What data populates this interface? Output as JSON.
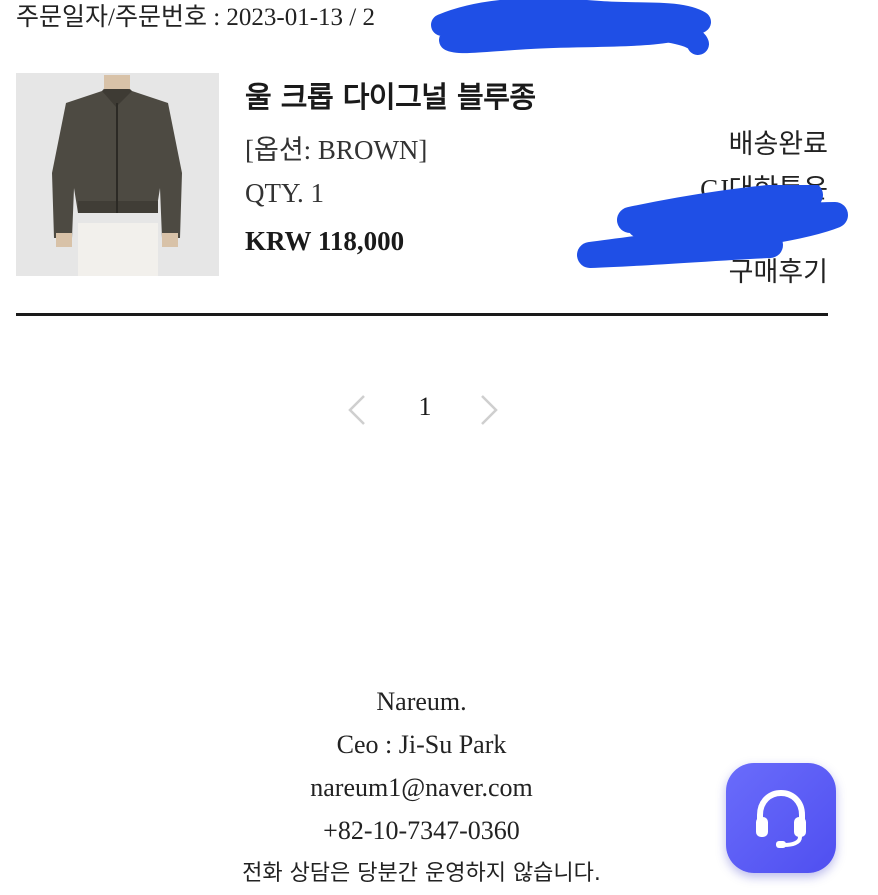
{
  "order": {
    "header_text": "주문일자/주문번호 : 2023-01-13 / 2",
    "redaction_tail": "8"
  },
  "product": {
    "image_icon": "jacket-photo",
    "name": "울 크롭 다이그널 블루종",
    "option": "[옵션: BROWN]",
    "qty": "QTY. 1",
    "price": "KRW 118,000"
  },
  "status": {
    "delivery_status": "배송완료",
    "courier": "CJ대한통운",
    "review_link": "구매후기"
  },
  "pagination": {
    "prev_icon": "chevron-left-icon",
    "current_page": "1",
    "next_icon": "chevron-right-icon"
  },
  "footer": {
    "company": "Nareum.",
    "ceo": "Ceo : Ji-Su Park",
    "email": "nareum1@naver.com",
    "phone": "+82-10-7347-0360",
    "notice": "전화 상담은 당분간 운영하지 않습니다."
  },
  "chat_button": {
    "icon": "headset-icon",
    "color": "#5b5bf5"
  },
  "colors": {
    "redaction": "#1f4fe6",
    "text": "#1a1a1a"
  }
}
